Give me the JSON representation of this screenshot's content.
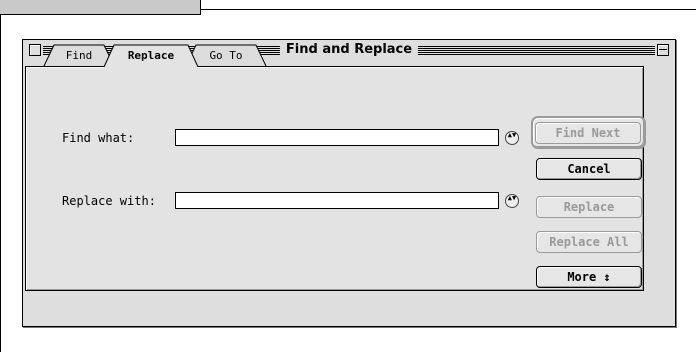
{
  "dialog": {
    "title": "Find and Replace",
    "tabs": [
      {
        "label": "Find",
        "active": false
      },
      {
        "label": "Replace",
        "active": true
      },
      {
        "label": "Go To",
        "active": false
      }
    ],
    "find_label": "Find what:",
    "find_value": "",
    "replace_label": "Replace with:",
    "replace_value": "",
    "stepper_glyph": "▲▼",
    "buttons": {
      "find_next": "Find Next",
      "cancel": "Cancel",
      "replace": "Replace",
      "replace_all": "Replace All",
      "more": "More ↕"
    }
  }
}
